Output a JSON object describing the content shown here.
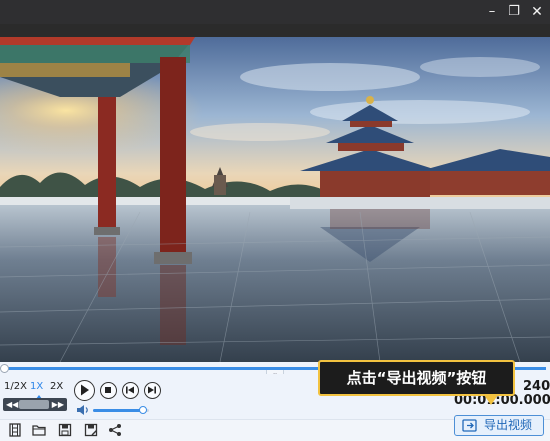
{
  "window": {
    "controls": [
      {
        "name": "minimize",
        "glyph": "–"
      },
      {
        "name": "restore",
        "glyph": "❐"
      },
      {
        "name": "close",
        "glyph": "✕"
      }
    ]
  },
  "viewer": {
    "icons": [
      "temple-of-heaven-photo"
    ]
  },
  "playback": {
    "progress": 0.0,
    "speed_options": [
      "1/2X",
      "1X",
      "2X"
    ],
    "selected_speed": "1X",
    "frame_step": {
      "prev_glyph": "◀◀",
      "next_glyph": "▶▶"
    },
    "buttons": [
      "play-icon",
      "stop-icon",
      "previous-icon",
      "next-icon"
    ],
    "volume": 0.9,
    "collapse_glyph": "⌄"
  },
  "time": {
    "frame_count": "240",
    "current": "00:01:00.000"
  },
  "tooltip": {
    "text": "点击“导出视频”按钮"
  },
  "toolbar": {
    "icons": [
      "film-strip-icon",
      "folder-open-icon",
      "save-icon",
      "save-as-icon",
      "share-icon"
    ],
    "export_label": "导出视频"
  },
  "colors": {
    "accent": "#3a8de6",
    "tooltip_border": "#f2c240",
    "export_text": "#2168b8"
  }
}
